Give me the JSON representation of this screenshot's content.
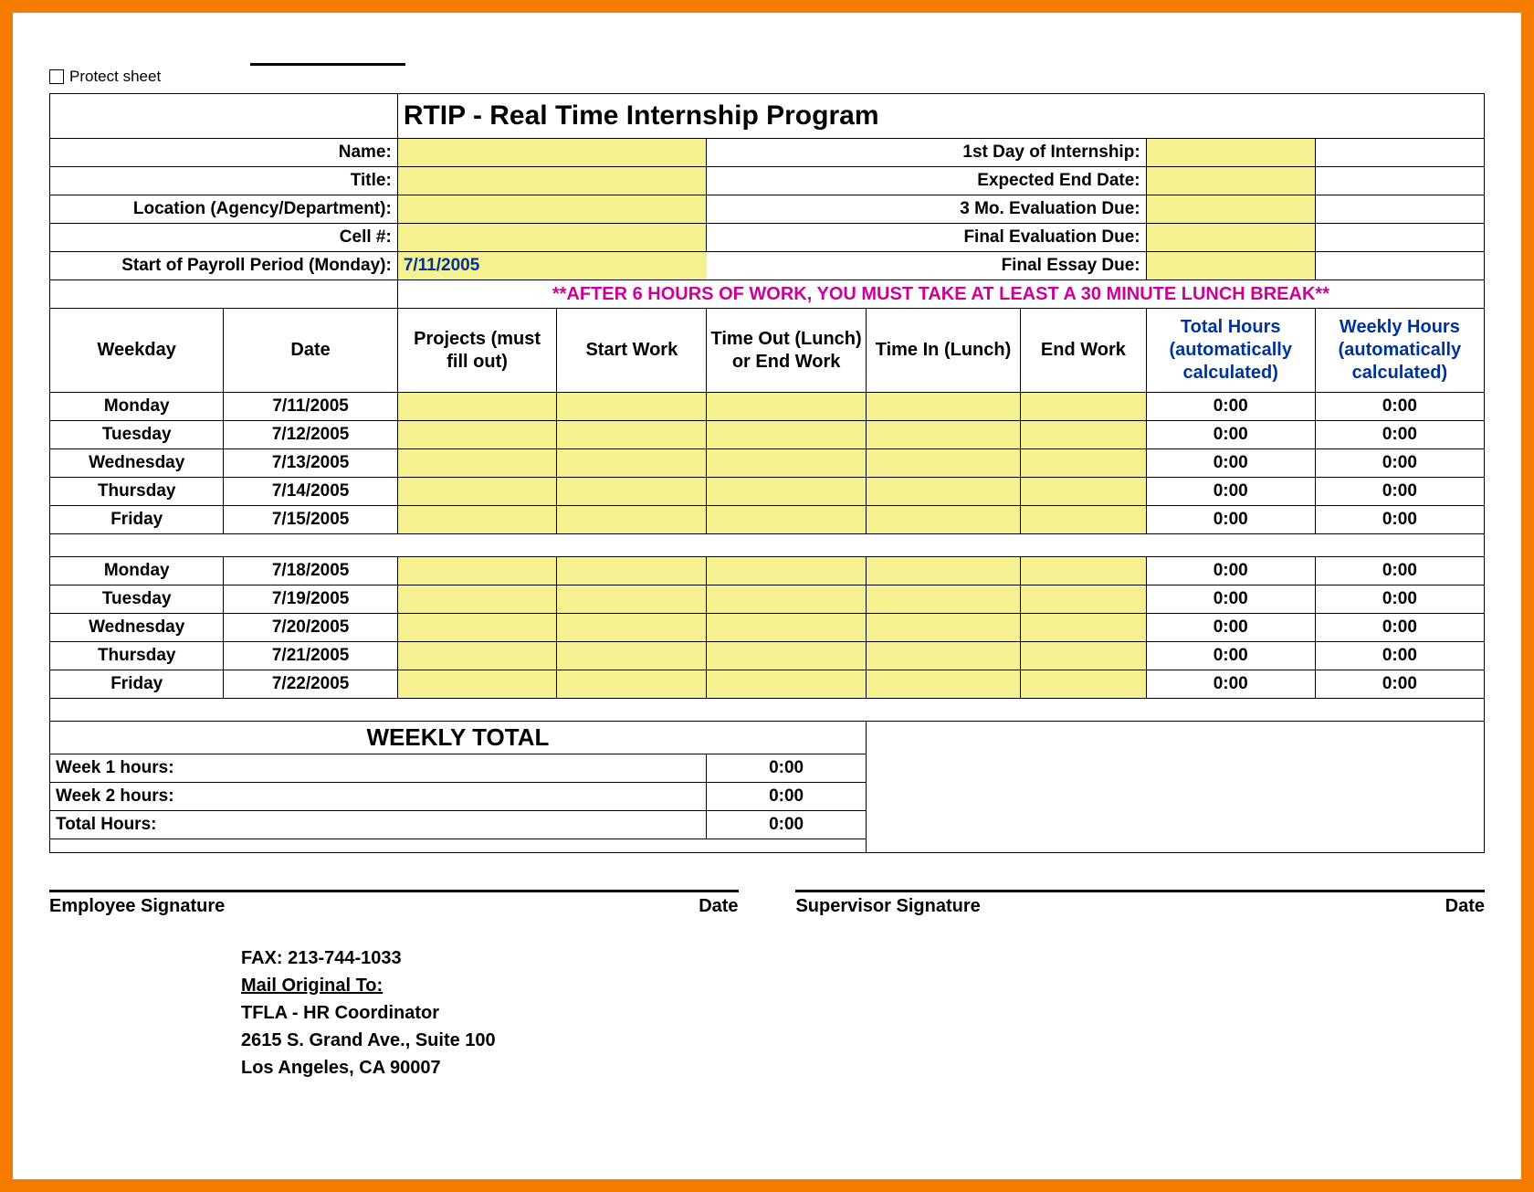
{
  "protect_label": "Protect sheet",
  "title": "RTIP - Real Time Internship Program",
  "labels": {
    "name": "Name:",
    "first_day": "1st Day of Internship:",
    "title_l": "Title:",
    "expected_end": "Expected End Date:",
    "location": "Location (Agency/Department):",
    "eval3": "3 Mo. Evaluation Due:",
    "cell": "Cell #:",
    "final_eval": "Final Evaluation Due:",
    "payroll": "Start of Payroll Period (Monday):",
    "final_essay": "Final Essay Due:"
  },
  "payroll_date": "7/11/2005",
  "notice": "**AFTER 6 HOURS OF WORK, YOU MUST TAKE AT LEAST A 30 MINUTE LUNCH BREAK**",
  "headers": {
    "weekday": "Weekday",
    "date": "Date",
    "projects": "Projects (must fill out)",
    "start": "Start Work",
    "timeout": "Time Out (Lunch) or End Work",
    "timein": "Time In (Lunch)",
    "end": "End Work",
    "total": "Total Hours (automatically calculated)",
    "weekly": "Weekly Hours (automatically calculated)"
  },
  "week1": [
    {
      "day": "Monday",
      "date": "7/11/2005",
      "total": "0:00",
      "weekly": "0:00"
    },
    {
      "day": "Tuesday",
      "date": "7/12/2005",
      "total": "0:00",
      "weekly": "0:00"
    },
    {
      "day": "Wednesday",
      "date": "7/13/2005",
      "total": "0:00",
      "weekly": "0:00"
    },
    {
      "day": "Thursday",
      "date": "7/14/2005",
      "total": "0:00",
      "weekly": "0:00"
    },
    {
      "day": "Friday",
      "date": "7/15/2005",
      "total": "0:00",
      "weekly": "0:00"
    }
  ],
  "week2": [
    {
      "day": "Monday",
      "date": "7/18/2005",
      "total": "0:00",
      "weekly": "0:00"
    },
    {
      "day": "Tuesday",
      "date": "7/19/2005",
      "total": "0:00",
      "weekly": "0:00"
    },
    {
      "day": "Wednesday",
      "date": "7/20/2005",
      "total": "0:00",
      "weekly": "0:00"
    },
    {
      "day": "Thursday",
      "date": "7/21/2005",
      "total": "0:00",
      "weekly": "0:00"
    },
    {
      "day": "Friday",
      "date": "7/22/2005",
      "total": "0:00",
      "weekly": "0:00"
    }
  ],
  "weekly_total_title": "WEEKLY TOTAL",
  "summary": {
    "w1_label": "Week 1 hours:",
    "w1_val": "0:00",
    "w2_label": "Week 2 hours:",
    "w2_val": "0:00",
    "tot_label": "Total Hours:",
    "tot_val": "0:00"
  },
  "sig": {
    "emp": "Employee Signature",
    "sup": "Supervisor Signature",
    "date": "Date"
  },
  "mail": {
    "fax": "FAX:  213-744-1033",
    "mail_to": "Mail Original To:",
    "l1": "TFLA - HR Coordinator",
    "l2": "2615 S. Grand Ave., Suite 100",
    "l3": "Los Angeles, CA 90007"
  }
}
